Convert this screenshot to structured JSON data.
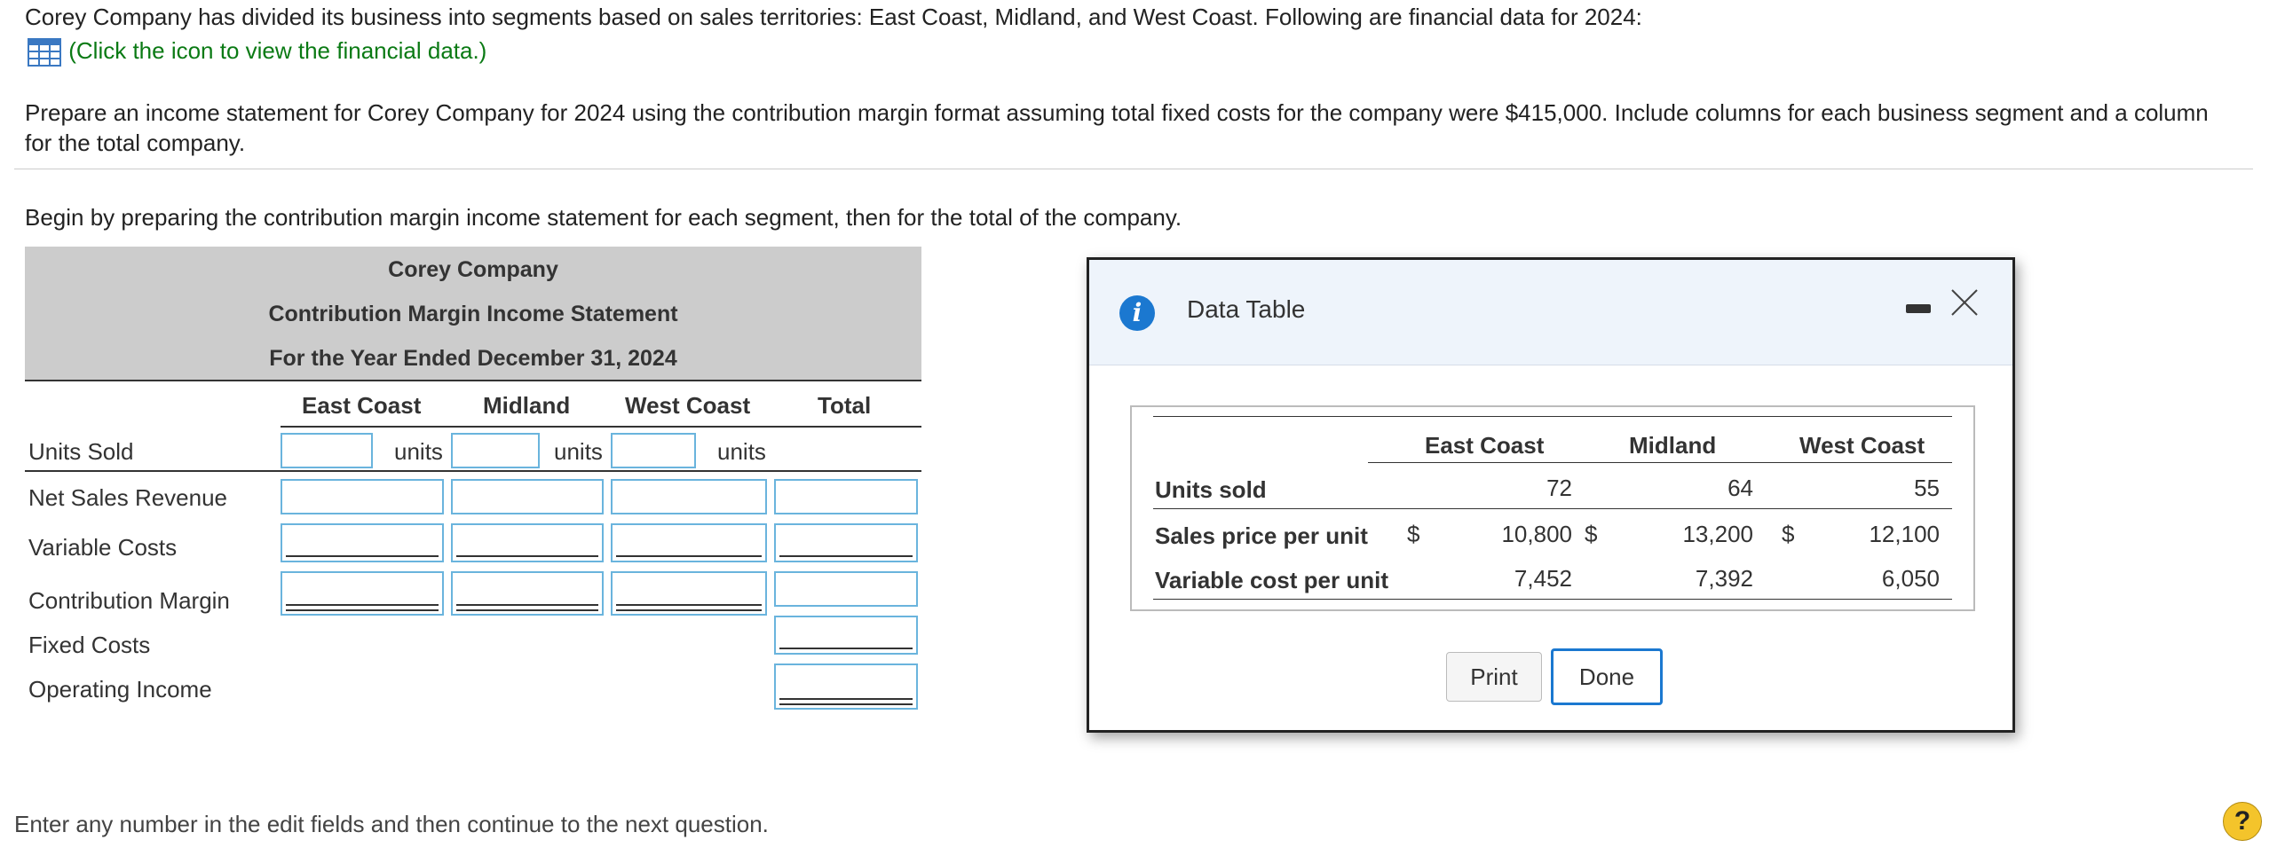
{
  "problem": {
    "intro": "Corey Company has divided its business into segments based on sales territories: East Coast, Midland, and West Coast. Following are financial data for 2024:",
    "link_text": "(Click the icon to view the financial data.)",
    "instruction_line1": "Prepare an income statement for Corey Company for 2024 using the contribution margin format assuming total fixed costs for the company were $415,000. Include columns for each business segment and a column",
    "instruction_line2": "for the total company.",
    "begin_text": "Begin by preparing the contribution margin income statement for each segment, then for the total of the company.",
    "footer_text": "Enter any number in the edit fields and then continue to the next question."
  },
  "statement": {
    "company": "Corey Company",
    "title": "Contribution Margin Income Statement",
    "period": "For the Year Ended December 31, 2024",
    "columns": [
      "East Coast",
      "Midland",
      "West Coast",
      "Total"
    ],
    "unit_label": "units",
    "rows": [
      "Units Sold",
      "Net Sales Revenue",
      "Variable Costs",
      "Contribution Margin",
      "Fixed Costs",
      "Operating Income"
    ]
  },
  "data_table": {
    "title": "Data Table",
    "columns": [
      "East Coast",
      "Midland",
      "West Coast"
    ],
    "rows": [
      {
        "label": "Units sold",
        "values": [
          "72",
          "64",
          "55"
        ]
      },
      {
        "label": "Sales price per unit",
        "currency": "$",
        "values": [
          "10,800",
          "13,200",
          "12,100"
        ]
      },
      {
        "label": "Variable cost per unit",
        "values": [
          "7,452",
          "7,392",
          "6,050"
        ]
      }
    ],
    "print_label": "Print",
    "done_label": "Done"
  },
  "help_label": "?",
  "colors": {
    "accent": "#1b78d0",
    "link": "#0a7a14",
    "input_border": "#6ab4dd",
    "header_bg": "#cccccc"
  }
}
